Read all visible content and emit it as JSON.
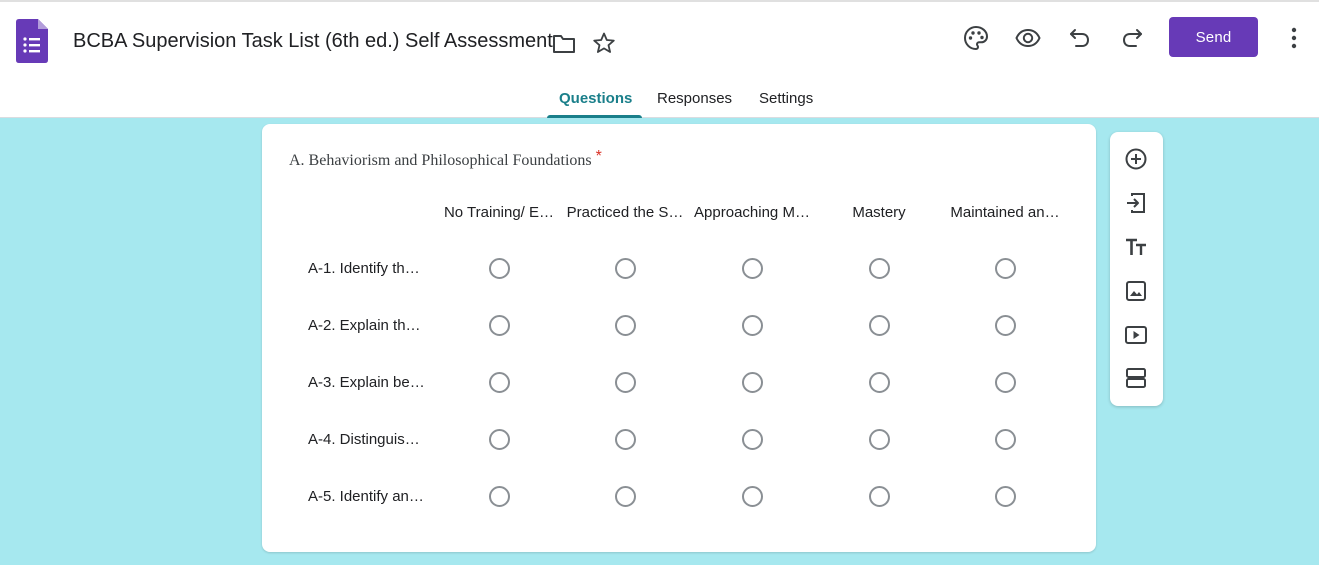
{
  "app": {
    "icon": "google-forms-icon",
    "title": "BCBA Supervision Task List (6th ed.) Self Assessment",
    "accent_color": "#673ab7",
    "theme_color": "#1a7f8a",
    "background_color": "#a6e8ef"
  },
  "header": {
    "icons": [
      "folder-icon",
      "star-icon",
      "palette-icon",
      "eye-icon",
      "undo-icon",
      "redo-icon",
      "more-vert-icon"
    ],
    "send_label": "Send"
  },
  "tabs": [
    {
      "label": "Questions",
      "active": true
    },
    {
      "label": "Responses",
      "active": false
    },
    {
      "label": "Settings",
      "active": false
    }
  ],
  "question": {
    "title": "A. Behaviorism and Philosophical Foundations",
    "required_marker": "*",
    "columns": [
      "No Training/ E…",
      "Practiced the S…",
      "Approaching M…",
      "Mastery",
      "Maintained an…"
    ],
    "rows": [
      "A-1. Identify th…",
      "A-2. Explain th…",
      "A-3. Explain be…",
      "A-4. Distinguis…",
      "A-5. Identify an…"
    ]
  },
  "toolbar": {
    "tools": [
      "add-question-icon",
      "import-questions-icon",
      "add-title-icon",
      "add-image-icon",
      "add-video-icon",
      "add-section-icon"
    ]
  }
}
